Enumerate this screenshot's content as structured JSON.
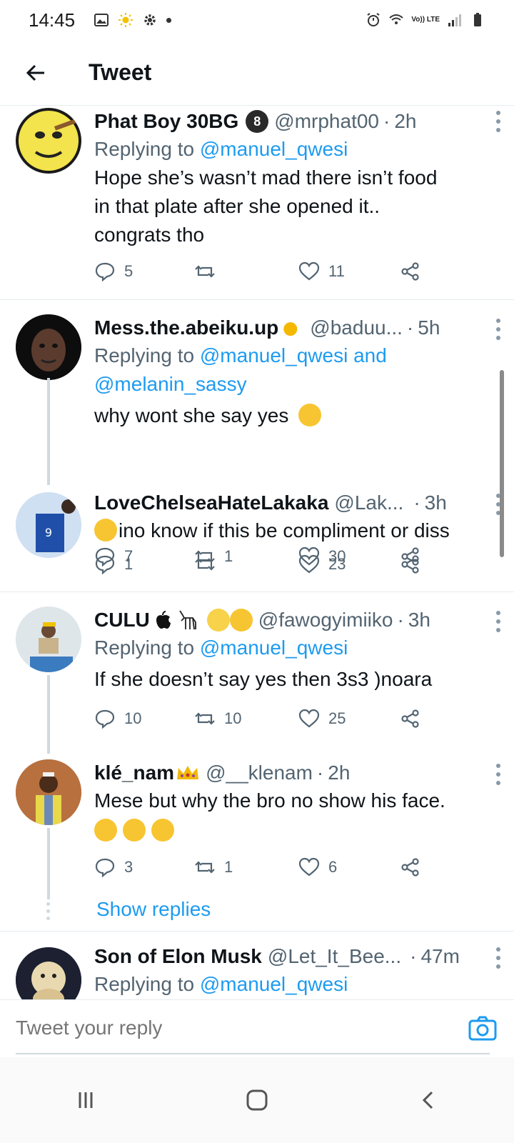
{
  "status_bar": {
    "time": "14:45",
    "network_label": "Vo)) LTE"
  },
  "header": {
    "title": "Tweet"
  },
  "tweets": [
    {
      "name": "Phat Boy 30BG",
      "badge": "8",
      "handle": "@mrphat00",
      "time": "2h",
      "replying_prefix": "Replying to",
      "replying_to": "@manuel_qwesi",
      "text_lines": [
        "Hope she’s wasn’t mad there isn’t food",
        "in that plate after she opened it..",
        "congrats tho"
      ],
      "replies": "5",
      "retweets": "",
      "likes": "11"
    },
    {
      "name": "Mess.the.abeiku.up",
      "handle": "@baduu...",
      "time": "5h",
      "replying_prefix": "Replying to",
      "replying_to": "@manuel_qwesi and",
      "replying_to_2": "@melanin_sassy",
      "text": "why wont she say yes",
      "replies": "7",
      "retweets": "1",
      "likes": "30"
    },
    {
      "name": "LoveChelseaHateLakaka",
      "handle": "@Lak...",
      "time": "3h",
      "text": "ino know if this be compliment or diss",
      "replies": "1",
      "retweets": "",
      "likes": "23"
    },
    {
      "name": "CULU",
      "handle": "@fawogyimiiko",
      "time": "3h",
      "replying_prefix": "Replying to",
      "replying_to": "@manuel_qwesi",
      "text": "If she doesn’t say yes then 3s3 )noara",
      "replies": "10",
      "retweets": "10",
      "likes": "25"
    },
    {
      "name": "klé_nam",
      "handle": "@__klenam",
      "time": "2h",
      "text": "Mese but why the bro no show his face.",
      "replies": "3",
      "retweets": "1",
      "likes": "6"
    },
    {
      "name": "Son of Elon Musk",
      "handle": "@Let_It_Bee...",
      "time": "47m",
      "replying_prefix": "Replying to",
      "replying_to": "@manuel_qwesi"
    }
  ],
  "show_replies": "Show replies",
  "composer": {
    "placeholder": "Tweet your reply"
  },
  "colors": {
    "link": "#1d9bf0",
    "text": "#0f1419",
    "muted": "#536471",
    "divider": "#e6ecf0"
  }
}
